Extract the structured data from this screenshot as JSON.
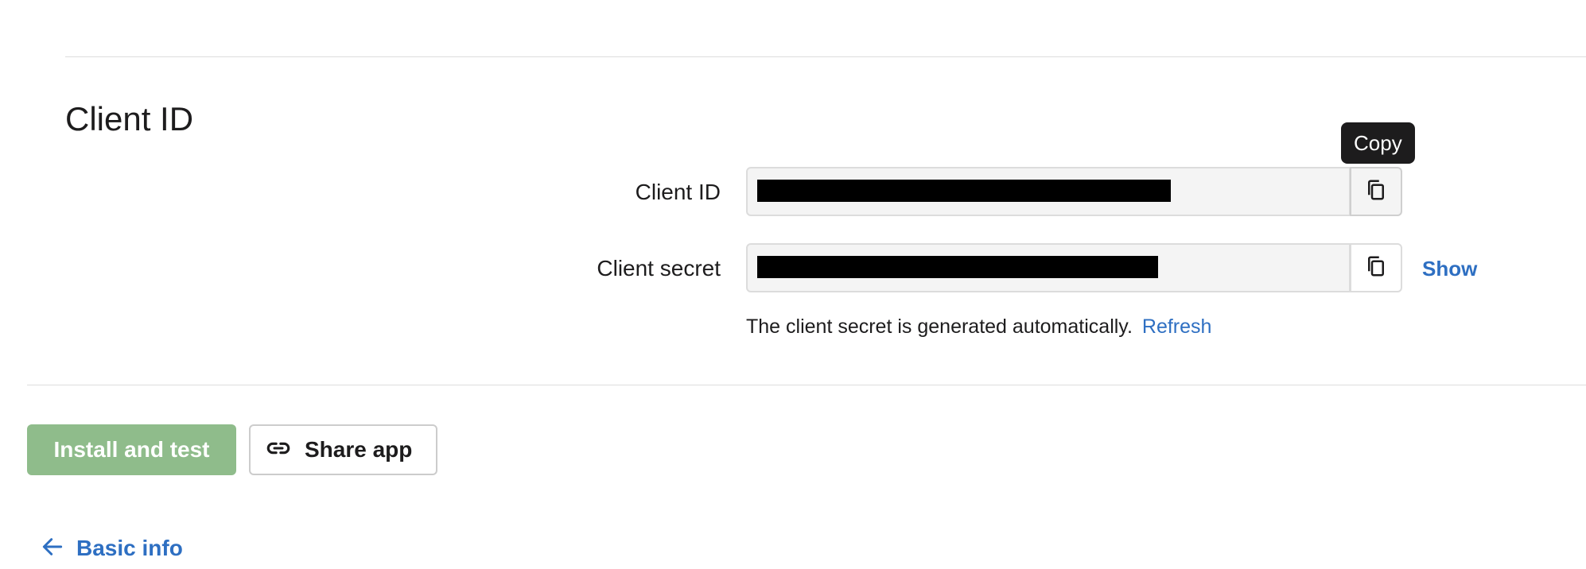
{
  "section": {
    "title": "Client ID"
  },
  "fields": {
    "client_id": {
      "label": "Client ID",
      "value_redacted": true
    },
    "client_secret": {
      "label": "Client secret",
      "value_redacted": true
    }
  },
  "tooltip": {
    "text": "Copy"
  },
  "actions": {
    "show_label": "Show",
    "helper_text": "The client secret is generated automatically.",
    "refresh_label": "Refresh"
  },
  "footer": {
    "install_label": "Install and test",
    "share_label": "Share app",
    "back_label": "Basic info"
  },
  "icons": {
    "copy": "copy-icon",
    "link": "link-icon",
    "back": "arrow-left-icon"
  },
  "colors": {
    "link": "#2e6fc2",
    "install_button": "#8fbc8b",
    "tooltip_bg": "#1d1c1d",
    "input_bg": "#f4f4f4"
  }
}
